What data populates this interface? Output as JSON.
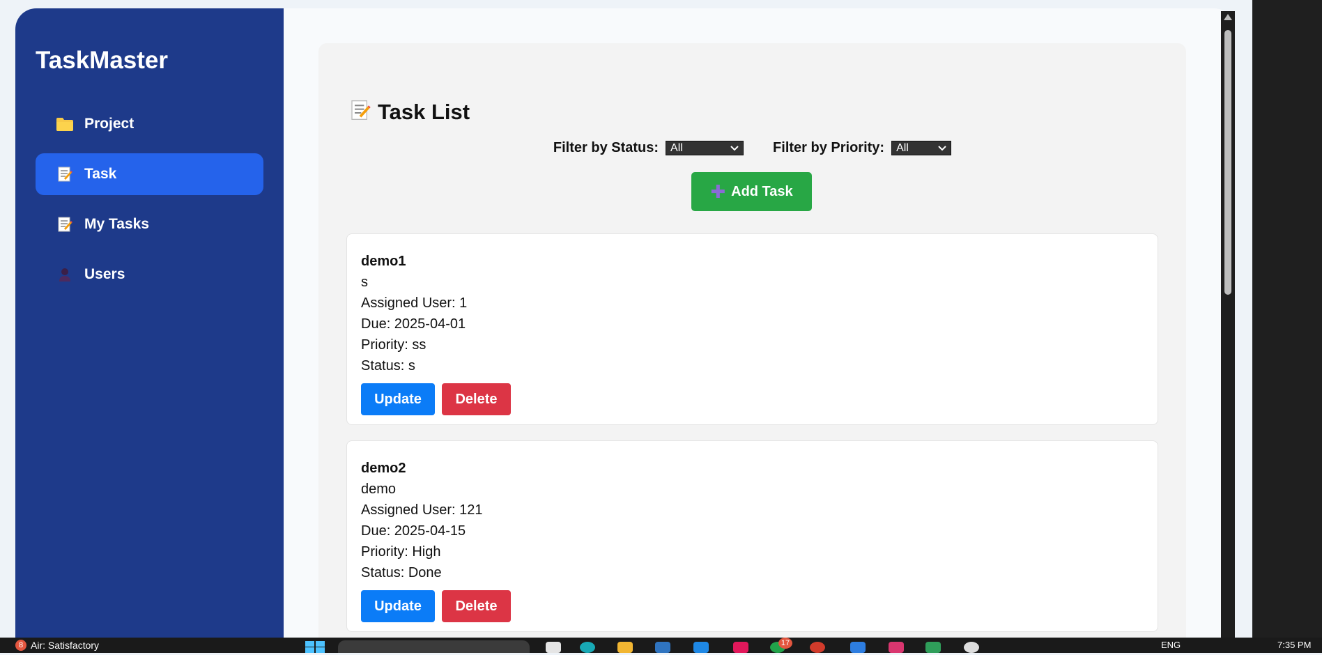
{
  "sidebar": {
    "brand": "TaskMaster",
    "items": [
      {
        "label": "Project",
        "icon": "folder-icon"
      },
      {
        "label": "Task",
        "icon": "memo-icon",
        "active": true
      },
      {
        "label": "My Tasks",
        "icon": "memo-icon"
      },
      {
        "label": "Users",
        "icon": "user-icon"
      }
    ]
  },
  "main": {
    "title": "Task List",
    "title_icon": "memo-icon",
    "filters": {
      "status_label": "Filter by Status:",
      "status_value": "All",
      "priority_label": "Filter by Priority:",
      "priority_value": "All"
    },
    "add_button": "Add Task",
    "tasks": [
      {
        "name": "demo1",
        "description": "s",
        "assigned": "Assigned User: 1",
        "due": "Due: 2025-04-01",
        "priority": "Priority: ss",
        "status": "Status: s",
        "update_label": "Update",
        "delete_label": "Delete"
      },
      {
        "name": "demo2",
        "description": "demo",
        "assigned": "Assigned User: 121",
        "due": "Due: 2025-04-15",
        "priority": "Priority: High",
        "status": "Status: Done",
        "update_label": "Update",
        "delete_label": "Delete"
      }
    ]
  },
  "taskbar": {
    "weather": "Air: Satisfactory",
    "weather_badge": "8",
    "app_badge": "17",
    "language": "ENG",
    "time": "7:35 PM"
  },
  "colors": {
    "sidebar_bg": "#1e3a8a",
    "active_item": "#2563eb",
    "add_button": "#28a745",
    "update_button": "#0b7cf7",
    "delete_button": "#dc3545"
  }
}
